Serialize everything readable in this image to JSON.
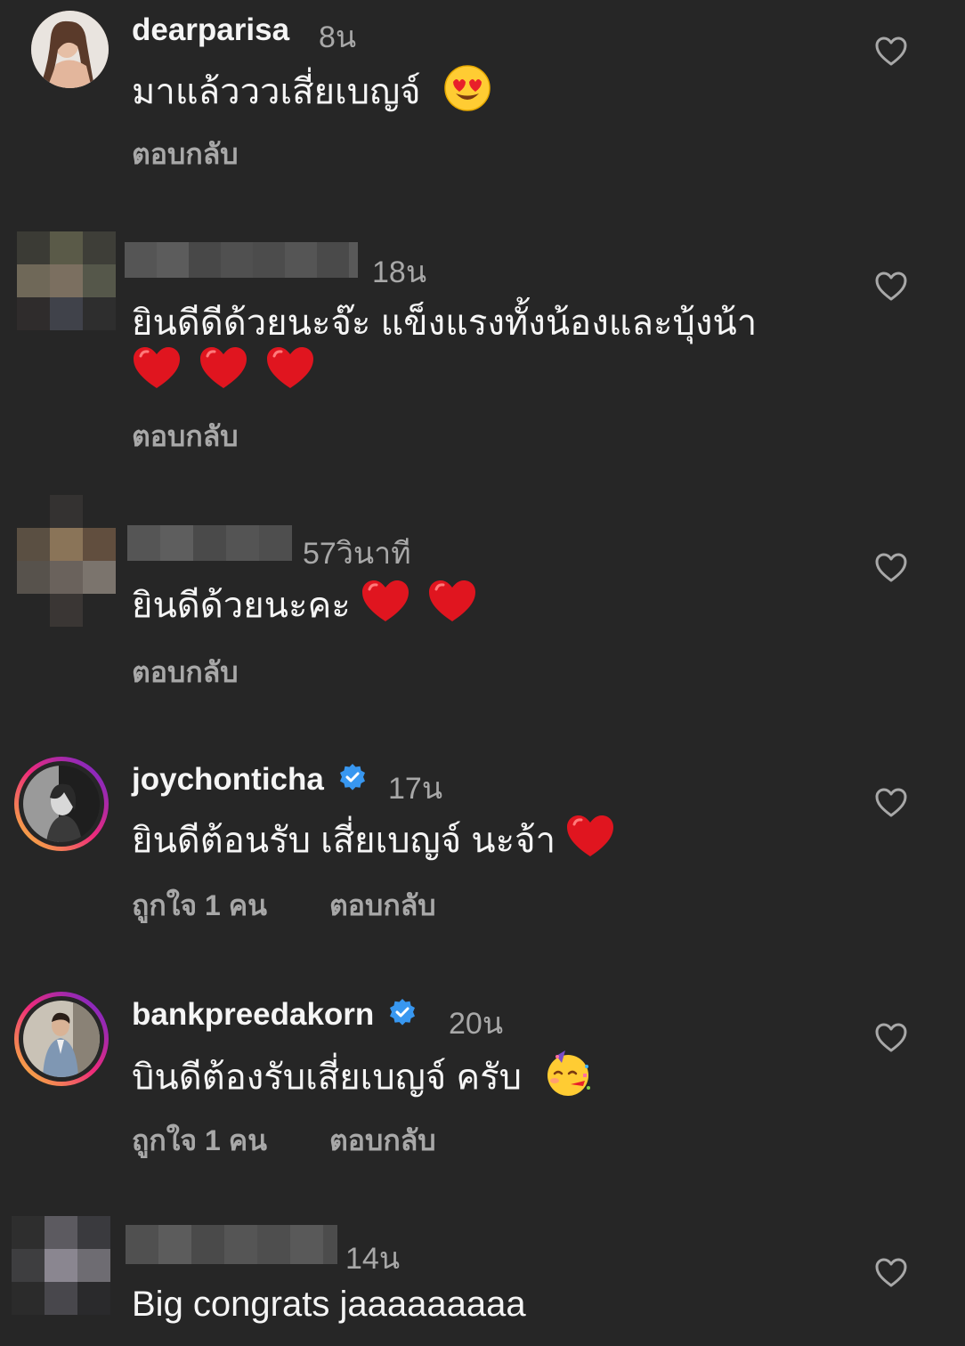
{
  "colors": {
    "background": "#262626",
    "text_primary": "#f5f5f5",
    "text_secondary": "#a8a8a8",
    "verified": "#3897f0",
    "heart_emoji": "#e0151f"
  },
  "comments": [
    {
      "username": "dearparisa",
      "time": "8น",
      "text": "มาแล้ววว​เสี่ยเบญจ์",
      "emoji": "heart-eyes-emoji",
      "reply_label": "ตอบกลับ"
    },
    {
      "username": "",
      "time": "18น",
      "text": "ยินดีดีด้วยนะจ๊ะ แข็งแรงทั้งน้องและบุ้งน้า",
      "emoji": "red-heart-emoji x3",
      "reply_label": "ตอบกลับ"
    },
    {
      "username": "",
      "time": "57วินาที",
      "text": "ยินดีด้วยนะคะ",
      "emoji": "red-heart-emoji x2",
      "reply_label": "ตอบกลับ"
    },
    {
      "username": "joychonticha",
      "verified": true,
      "time": "17น",
      "text": "ยินดีต้อนรับ เสี่ยเบญจ์ นะจ้า",
      "emoji": "red-heart-emoji",
      "likes_label": "ถูกใจ 1 คน",
      "reply_label": "ตอบกลับ"
    },
    {
      "username": "bankpreedakorn",
      "verified": true,
      "time": "20น",
      "text": "บินดีต้องรับเสี่ยเบญจ์ ครับ",
      "emoji": "partying-face-emoji",
      "likes_label": "ถูกใจ 1 คน",
      "reply_label": "ตอบกลับ"
    },
    {
      "username": "",
      "time": "14น",
      "text": "Big congrats jaaaaaaaaa"
    }
  ]
}
